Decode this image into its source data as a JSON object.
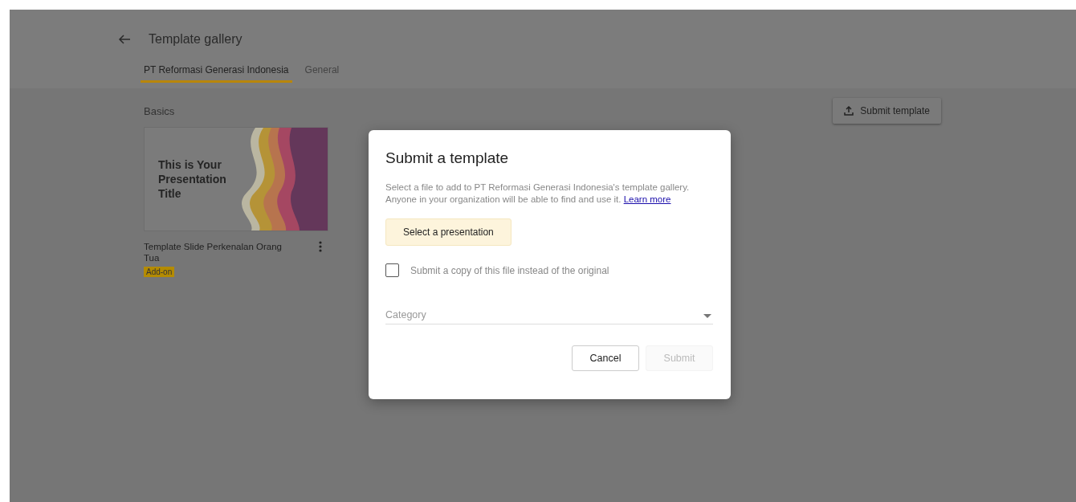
{
  "header": {
    "title": "Template gallery"
  },
  "tabs": [
    {
      "label": "PT Reformasi Generasi Indonesia",
      "selected": true
    },
    {
      "label": "General",
      "selected": false
    }
  ],
  "section": {
    "title": "Basics"
  },
  "submit_template_button": {
    "label": "Submit template"
  },
  "templates": [
    {
      "slide_title": "This is Your Presentation Title",
      "name": "Template Slide Perkenalan Orang Tua",
      "badge": "Add-on"
    }
  ],
  "dialog": {
    "title": "Submit a template",
    "description": "Select a file to add to PT Reformasi Generasi Indonesia's template gallery. Anyone in your organization will be able to find and use it.",
    "link": "Learn more",
    "select_button": "Select a presentation",
    "copy_checkbox": {
      "label": "Submit a copy of this file instead of the original",
      "checked": false
    },
    "category": {
      "placeholder": "Category"
    },
    "buttons": [
      {
        "label": "Cancel",
        "disabled": false
      },
      {
        "label": "Submit",
        "disabled": true
      }
    ]
  }
}
